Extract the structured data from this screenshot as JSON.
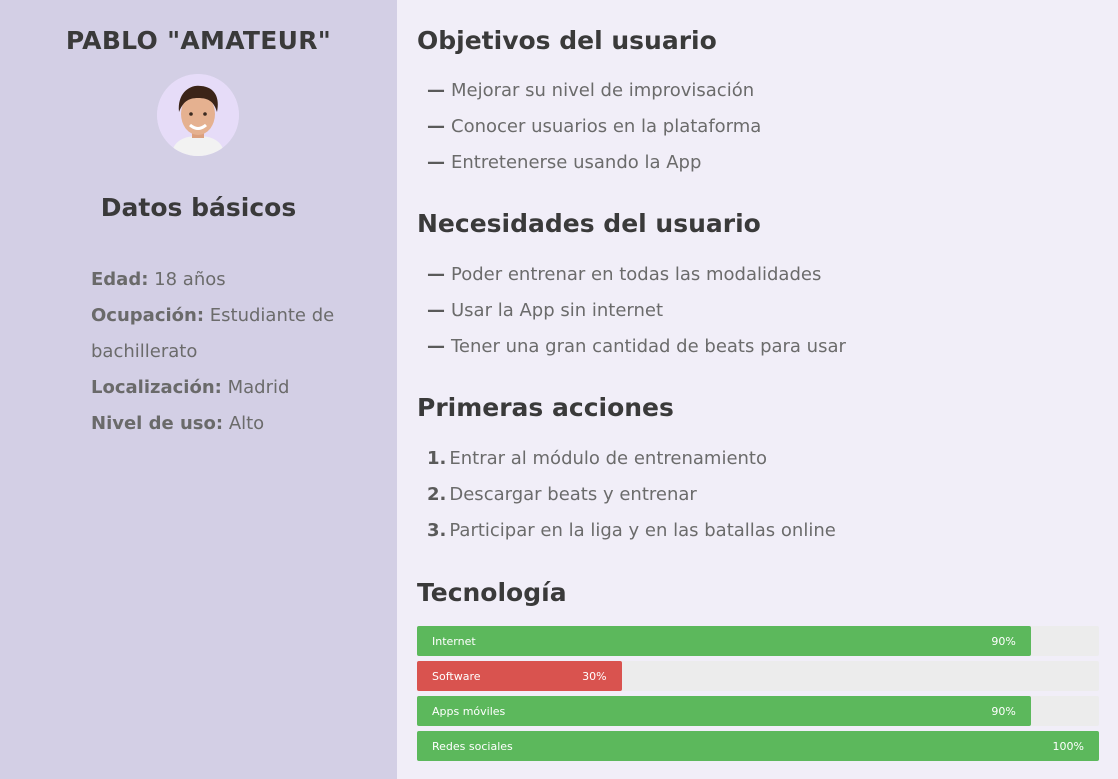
{
  "persona": {
    "name": "PABLO \"AMATEUR\"",
    "basic_title": "Datos básicos",
    "facts": [
      {
        "label": "Edad:",
        "value": "18 años"
      },
      {
        "label": "Ocupación:",
        "value": "Estudiante de bachillerato"
      },
      {
        "label": "Localización:",
        "value": "Madrid"
      },
      {
        "label": "Nivel de uso:",
        "value": "Alto"
      }
    ]
  },
  "goals": {
    "title": "Objetivos del usuario",
    "items": [
      "Mejorar su nivel de improvisación",
      "Conocer usuarios en la plataforma",
      "Entretenerse usando la App"
    ]
  },
  "needs": {
    "title": "Necesidades del usuario",
    "items": [
      "Poder entrenar en todas las modalidades",
      "Usar la App sin internet",
      "Tener una gran cantidad de beats para usar"
    ]
  },
  "actions": {
    "title": "Primeras acciones",
    "items": [
      {
        "num": "1.",
        "text": "Entrar al módulo de entrenamiento"
      },
      {
        "num": "2.",
        "text": "Descargar beats y entrenar"
      },
      {
        "num": "3.",
        "text": "Participar en la liga y en las batallas online"
      }
    ]
  },
  "tech": {
    "title": "Tecnología",
    "bars": [
      {
        "label": "Internet",
        "percent_label": "90%",
        "value": 0.9,
        "color": "#5cb85c"
      },
      {
        "label": "Software",
        "percent_label": "30%",
        "value": 0.3,
        "color": "#d9534f"
      },
      {
        "label": "Apps móviles",
        "percent_label": "90%",
        "value": 0.9,
        "color": "#5cb85c"
      },
      {
        "label": "Redes sociales",
        "percent_label": "100%",
        "value": 1.0,
        "color": "#5cb85c"
      }
    ]
  },
  "colors": {
    "sidebar_bg": "#d3cfe5",
    "main_bg": "#f1eef8",
    "bar_green": "#5cb85c",
    "bar_red": "#d9534f"
  }
}
